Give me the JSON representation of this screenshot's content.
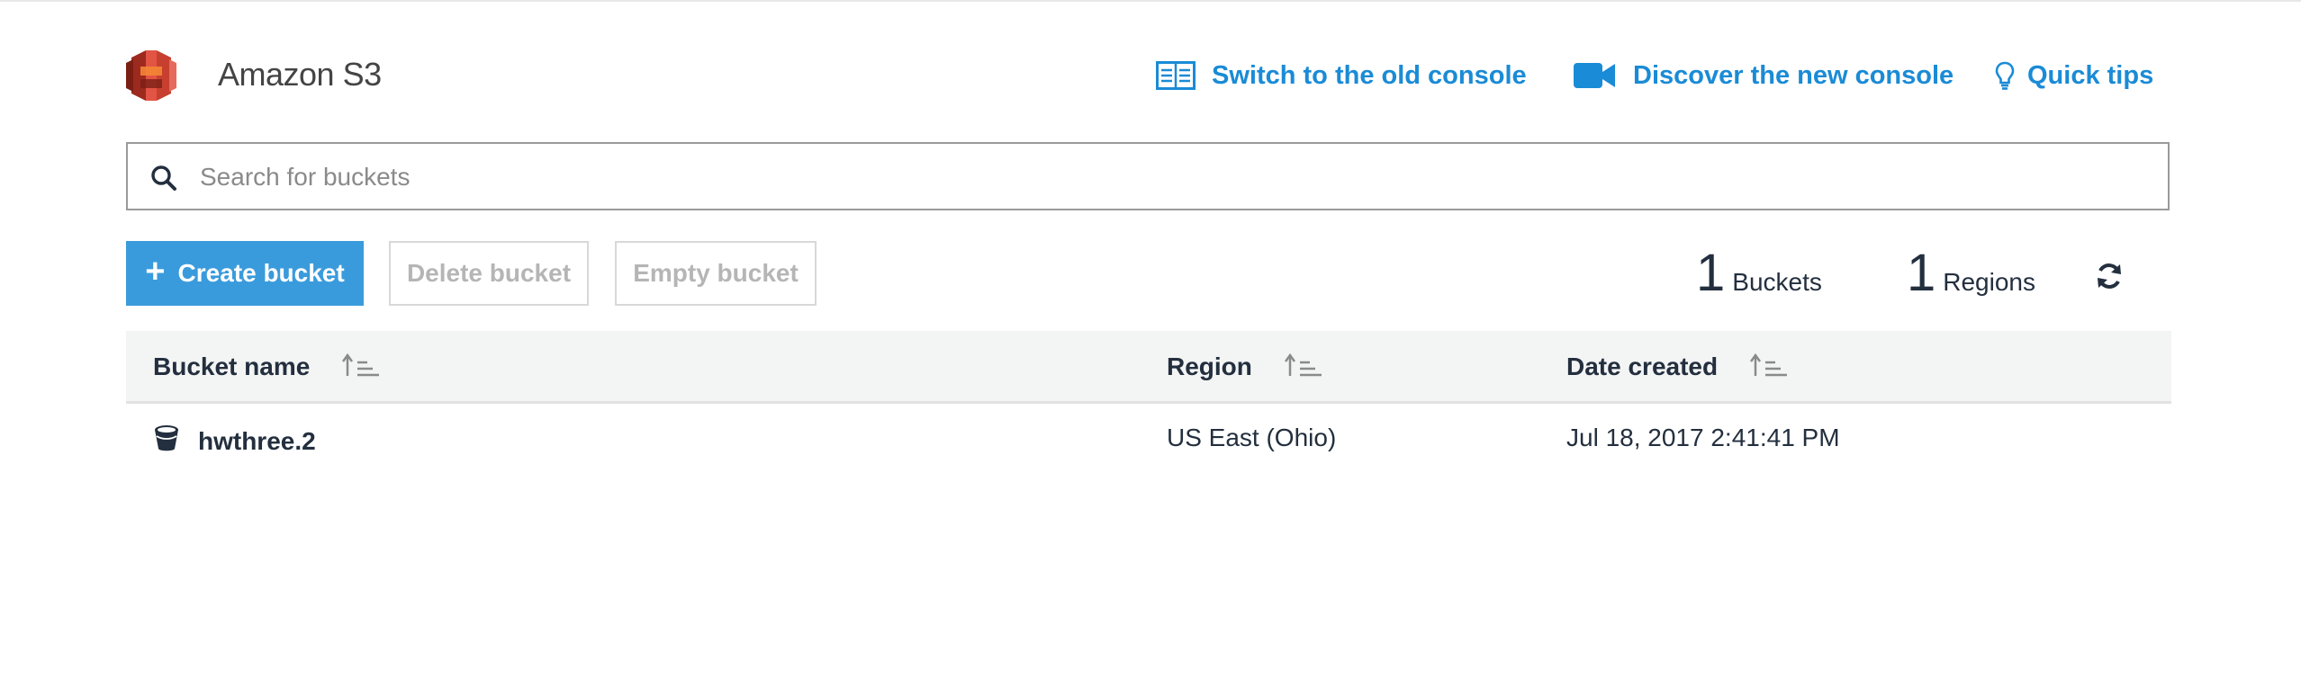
{
  "app": {
    "title": "Amazon S3"
  },
  "header_links": {
    "old_console": "Switch to the old console",
    "new_console": "Discover the new console",
    "quick_tips": "Quick tips"
  },
  "search": {
    "placeholder": "Search for buckets",
    "value": ""
  },
  "actions": {
    "create": "Create bucket",
    "delete": "Delete bucket",
    "empty": "Empty bucket"
  },
  "stats": {
    "buckets_count": "1",
    "buckets_label": "Buckets",
    "regions_count": "1",
    "regions_label": "Regions"
  },
  "table": {
    "headers": {
      "name": "Bucket name",
      "region": "Region",
      "date": "Date created"
    },
    "rows": [
      {
        "name": "hwthree.2",
        "region": "US East (Ohio)",
        "date": "Jul 18, 2017 2:41:41 PM"
      }
    ]
  },
  "colors": {
    "link": "#1a8bd6",
    "primary_button": "#3a9bdc",
    "s3_logo": "#e25444",
    "header_row_bg": "#f3f4f4"
  },
  "icons": [
    "s3-logo",
    "console-icon",
    "video-camera-icon",
    "lightbulb-icon",
    "search-icon",
    "plus-icon",
    "refresh-icon",
    "sort-icon",
    "bucket-icon"
  ]
}
